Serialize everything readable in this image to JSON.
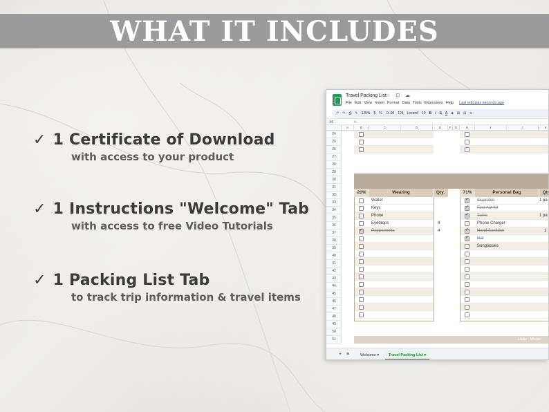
{
  "banner": {
    "title": "WHAT IT INCLUDES"
  },
  "features": [
    {
      "check": "✓",
      "title": "1 Certificate of Download",
      "subtitle": "with access to your product"
    },
    {
      "check": "✓",
      "title": "1 Instructions \"Welcome\" Tab",
      "subtitle": "with access to free Video Tutorials"
    },
    {
      "check": "✓",
      "title": "1 Packing List Tab",
      "subtitle": "to track trip information & travel items"
    }
  ],
  "sheet": {
    "doc_title": "Travel Packing List",
    "title_icons": "☆ ⊡ ☁",
    "menu": [
      "File",
      "Edit",
      "View",
      "Insert",
      "Format",
      "Data",
      "Tools",
      "Extensions",
      "Help"
    ],
    "last_edit": "Last edit was seconds ago",
    "toolbar": {
      "zoom": "125%",
      "currency": "$",
      "percent": "%",
      "decimals": ".0 .00",
      "format": "123",
      "font": "Lexend",
      "size": "10",
      "bold": "B",
      "italic": "I",
      "strike": "S",
      "color": "A"
    },
    "cell_ref": "X6",
    "fx": "fx",
    "columns": [
      "A",
      "B",
      "C",
      "D",
      "E",
      "F",
      "G",
      "H",
      "I",
      "J",
      "K"
    ],
    "row_numbers": [
      "24",
      "25",
      "26",
      "27",
      "28",
      "29",
      "30",
      "31",
      "32",
      "33",
      "34",
      "35",
      "36",
      "37",
      "38",
      "39",
      "40",
      "41",
      "42",
      "43",
      "44",
      "45",
      "46",
      "47",
      "48",
      "49",
      "50",
      "51"
    ],
    "wearing": {
      "percent": "20%",
      "header": "Wearing",
      "qty_header": "Qty.",
      "items": [
        {
          "label": "Wallet",
          "qty": "",
          "checked": false
        },
        {
          "label": "Keys",
          "qty": "",
          "checked": false
        },
        {
          "label": "Phone",
          "qty": "",
          "checked": false
        },
        {
          "label": "Eyedrops",
          "qty": "4",
          "checked": false
        },
        {
          "label": "Peppermints",
          "qty": "4",
          "checked": true
        }
      ]
    },
    "personal_bag": {
      "percent": "71%",
      "header": "Personal Bag",
      "qty_header": "Qty",
      "items": [
        {
          "label": "Ibuprofen",
          "qty": "1 pa",
          "checked": true
        },
        {
          "label": "First Aid Kit",
          "qty": "",
          "checked": true
        },
        {
          "label": "Tums",
          "qty": "1 pa",
          "checked": true
        },
        {
          "label": "Phone Charger",
          "qty": "",
          "checked": false
        },
        {
          "label": "Hand Sanitizer",
          "qty": "1",
          "checked": true
        },
        {
          "label": "Hat",
          "qty": "",
          "checked": true
        },
        {
          "label": "Sunglasses",
          "qty": "",
          "checked": false
        }
      ]
    },
    "footer_brand": "Lilake · Minden",
    "tabs": [
      {
        "label": "Welcome",
        "arrow": "▾"
      },
      {
        "label": "Travel Packing List",
        "arrow": "▾"
      }
    ],
    "tab_controls": {
      "add": "+",
      "all": "≡"
    }
  }
}
